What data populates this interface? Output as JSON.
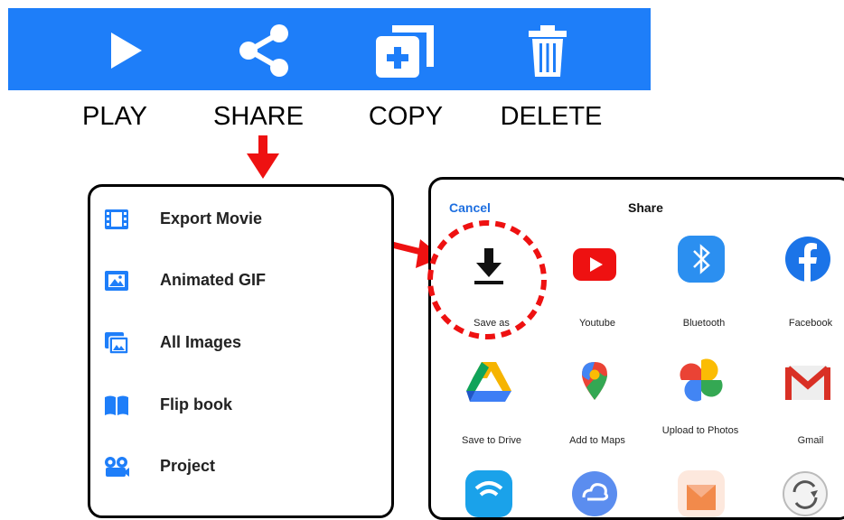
{
  "toolbar": {
    "play_label": "PLAY",
    "share_label": "SHARE",
    "copy_label": "COPY",
    "delete_label": "DELETE",
    "background": "#1e7ef9"
  },
  "share_menu": {
    "items": [
      {
        "label": "Export Movie",
        "icon": "film-icon"
      },
      {
        "label": "Animated GIF",
        "icon": "image-icon"
      },
      {
        "label": "All Images",
        "icon": "images-icon"
      },
      {
        "label": "Flip book",
        "icon": "book-icon"
      },
      {
        "label": "Project",
        "icon": "projector-icon"
      }
    ]
  },
  "share_sheet": {
    "cancel_label": "Cancel",
    "title": "Share",
    "apps": [
      {
        "label": "Save as",
        "icon": "download-icon"
      },
      {
        "label": "Youtube",
        "icon": "youtube-icon"
      },
      {
        "label": "Bluetooth",
        "icon": "bluetooth-icon"
      },
      {
        "label": "Facebook",
        "icon": "facebook-icon"
      },
      {
        "label": "Save to Drive",
        "icon": "google-drive-icon"
      },
      {
        "label": "Add to Maps",
        "icon": "google-maps-icon"
      },
      {
        "label": "Upload to Photos",
        "icon": "google-photos-icon"
      },
      {
        "label": "Gmail",
        "icon": "gmail-icon"
      }
    ]
  },
  "colors": {
    "accent_blue": "#1e7ef9",
    "annotation_red": "#ee1111"
  }
}
